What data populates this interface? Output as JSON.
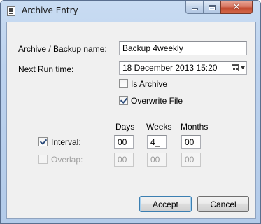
{
  "window": {
    "title": "Archive Entry",
    "close_symbol": "✕"
  },
  "form": {
    "name_label": "Archive / Backup name:",
    "name_value": "Backup 4weekly",
    "next_run_label": "Next Run time:",
    "next_run_value": "18 December 2013 15:20",
    "is_archive_label": "Is Archive",
    "is_archive_checked": false,
    "overwrite_label": "Overwrite File",
    "overwrite_checked": true
  },
  "schedule": {
    "columns": [
      "Days",
      "Weeks",
      "Months"
    ],
    "interval": {
      "label": "Interval:",
      "checked": true,
      "days": "00",
      "weeks": "4_",
      "months": "00"
    },
    "overlap": {
      "label": "Overlap:",
      "checked": false,
      "enabled": false,
      "days": "00",
      "weeks": "00",
      "months": "00"
    }
  },
  "buttons": {
    "accept": "Accept",
    "cancel": "Cancel"
  },
  "icons": {
    "app": "document-icon",
    "date_picker": "calendar-icon"
  }
}
